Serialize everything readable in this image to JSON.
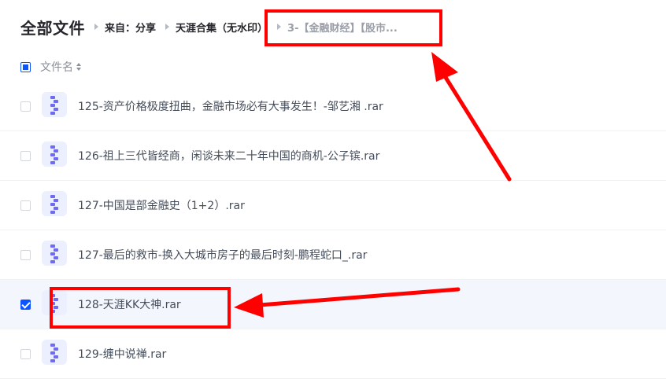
{
  "breadcrumb": {
    "root": "全部文件",
    "items": [
      "来自：分享",
      "天涯合集（无水印）"
    ],
    "current": "3-【金融财经】【股市..."
  },
  "list_header": {
    "select_all_state": "partial",
    "name_column": "文件名",
    "sort_icon": "sort-icon"
  },
  "files": [
    {
      "name": "125-资产价格极度扭曲，金融市场必有大事发生！-邹艺湘 .rar",
      "checked": false,
      "icon": "archive-file-icon"
    },
    {
      "name": "126-祖上三代皆经商，闲谈未来二十年中国的商机-公子镔.rar",
      "checked": false,
      "icon": "archive-file-icon"
    },
    {
      "name": "127-中国是部金融史（1+2）.rar",
      "checked": false,
      "icon": "archive-file-icon"
    },
    {
      "name": "127-最后的救市-换入大城市房子的最后时刻-鹏程蛇口_.rar",
      "checked": false,
      "icon": "archive-file-icon"
    },
    {
      "name": "128-天涯KK大神.rar",
      "checked": true,
      "icon": "archive-file-icon"
    },
    {
      "name": "129-缠中说禅.rar",
      "checked": false,
      "icon": "archive-file-icon"
    }
  ],
  "colors": {
    "accent": "#0d53ff",
    "annotation": "#ff0000",
    "selected_row_bg": "#f4f6fd",
    "file_icon": "#6f6bf0"
  }
}
